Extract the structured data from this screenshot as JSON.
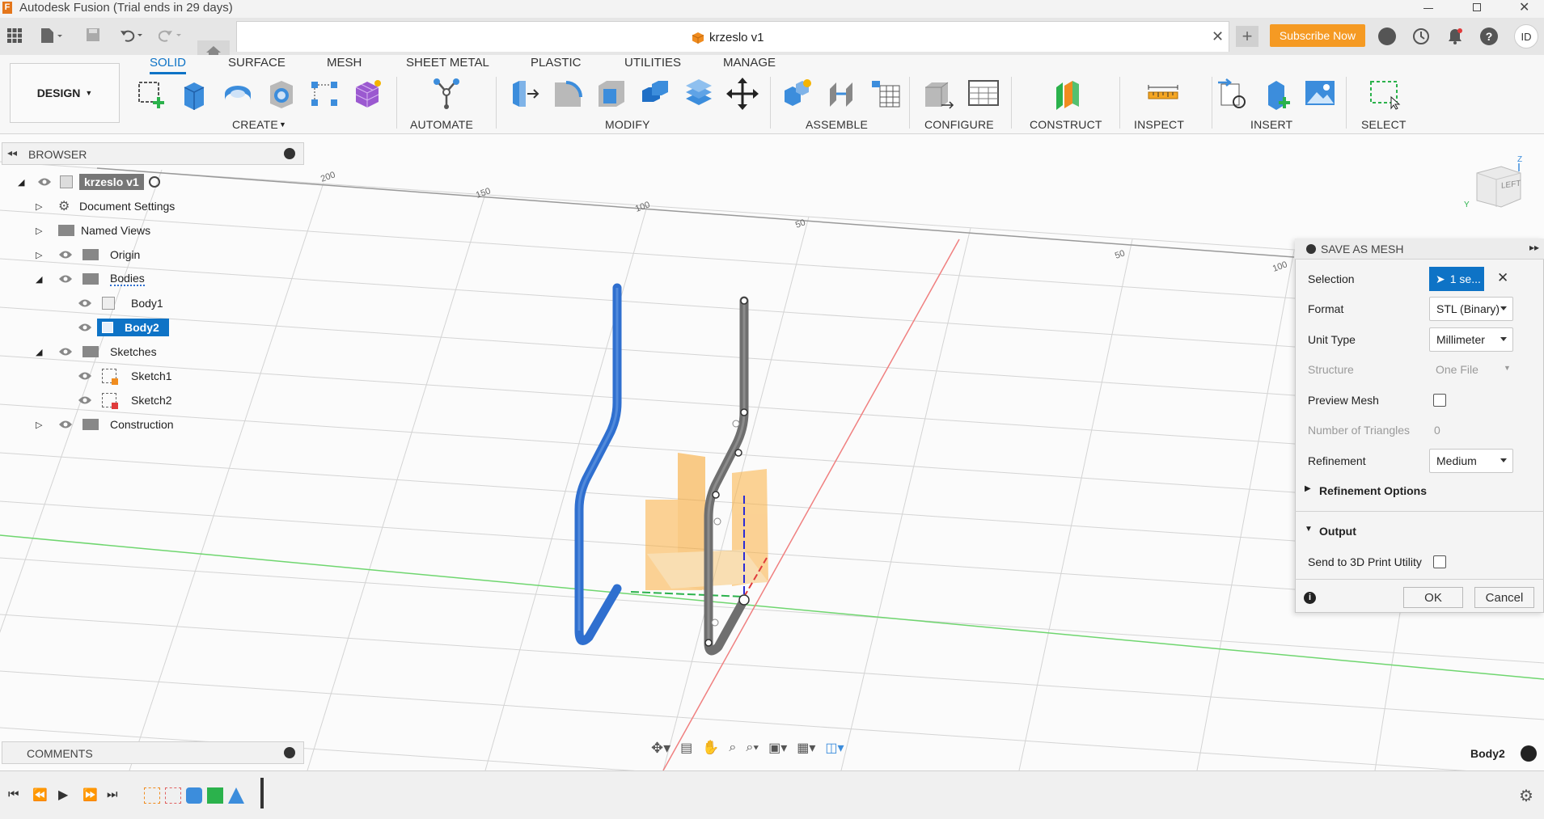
{
  "app": {
    "window_title": "Autodesk Fusion (Trial ends in 29 days)",
    "doc_tab": "krzeslo v1",
    "subscribe": "Subscribe Now",
    "user": "ID"
  },
  "ribbon": {
    "workspace": "DESIGN",
    "tabs": [
      "SOLID",
      "SURFACE",
      "MESH",
      "SHEET METAL",
      "PLASTIC",
      "UTILITIES",
      "MANAGE"
    ],
    "groups": [
      "CREATE",
      "AUTOMATE",
      "MODIFY",
      "ASSEMBLE",
      "CONFIGURE",
      "CONSTRUCT",
      "INSPECT",
      "INSERT",
      "SELECT"
    ]
  },
  "browser": {
    "title": "BROWSER",
    "root": "krzeslo v1",
    "items": [
      {
        "label": "Document Settings"
      },
      {
        "label": "Named Views"
      },
      {
        "label": "Origin"
      },
      {
        "label": "Bodies"
      },
      {
        "label": "Body1"
      },
      {
        "label": "Body2"
      },
      {
        "label": "Sketches"
      },
      {
        "label": "Sketch1"
      },
      {
        "label": "Sketch2"
      },
      {
        "label": "Construction"
      }
    ]
  },
  "dialog": {
    "title": "SAVE AS MESH",
    "selection_label": "Selection",
    "selection_value": "1 se...",
    "format_label": "Format",
    "format_value": "STL (Binary)",
    "unit_label": "Unit Type",
    "unit_value": "Millimeter",
    "structure_label": "Structure",
    "structure_value": "One File",
    "preview_label": "Preview Mesh",
    "triangles_label": "Number of Triangles",
    "triangles_value": "0",
    "refinement_label": "Refinement",
    "refinement_value": "Medium",
    "refinement_options": "Refinement Options",
    "output": "Output",
    "send_print": "Send to 3D Print Utility",
    "ok": "OK",
    "cancel": "Cancel",
    "preview_checked": false,
    "send_print_checked": false
  },
  "comments": {
    "title": "COMMENTS"
  },
  "viewcube": {
    "face": "LEFT",
    "axis_z": "Z",
    "axis_y": "Y"
  },
  "status": {
    "selected_body": "Body2"
  },
  "colors": {
    "accent": "#0e73c6",
    "subscribe": "#f59a23",
    "body1": "#2f6fcf",
    "body2": "#6f6f6f",
    "plane": "#fbb040"
  }
}
